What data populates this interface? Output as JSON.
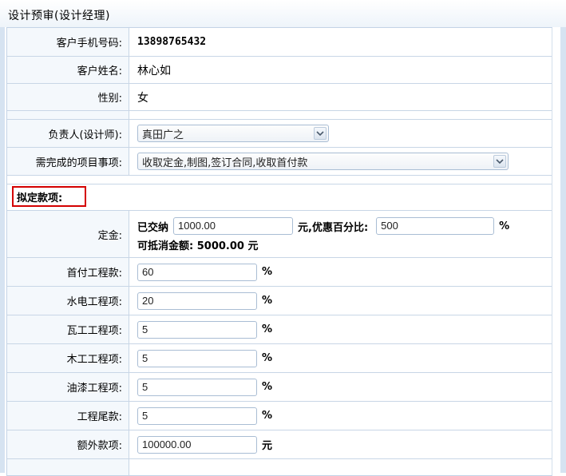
{
  "page_title": "设计预审(设计经理)",
  "customer": {
    "phone_label": "客户手机号码:",
    "phone_value": "13898765432",
    "name_label": "客户姓名:",
    "name_value": "林心如",
    "gender_label": "性别:",
    "gender_value": "女"
  },
  "assignment": {
    "designer_label": "负责人(设计师):",
    "designer_value": "真田广之",
    "tasks_label": "需完成的项目事项:",
    "tasks_value": "收取定金,制图,签订合同,收取首付款"
  },
  "section_title": "拟定款项:",
  "deposit": {
    "label": "定金:",
    "paid_prefix": "已交纳",
    "paid_value": "1000.00",
    "discount_label": "元,优惠百分比:",
    "discount_value": "500",
    "percent": "%",
    "offset_text": "可抵消金额: 5000.00 元"
  },
  "items": [
    {
      "label": "首付工程款:",
      "value": "60",
      "unit": "%"
    },
    {
      "label": "水电工程项:",
      "value": "20",
      "unit": "%"
    },
    {
      "label": "瓦工工程项:",
      "value": "5",
      "unit": "%"
    },
    {
      "label": "木工工程项:",
      "value": "5",
      "unit": "%"
    },
    {
      "label": "油漆工程项:",
      "value": "5",
      "unit": "%"
    },
    {
      "label": "工程尾款:",
      "value": "5",
      "unit": "%"
    },
    {
      "label": "额外款项:",
      "value": "100000.00",
      "unit": "元"
    }
  ]
}
